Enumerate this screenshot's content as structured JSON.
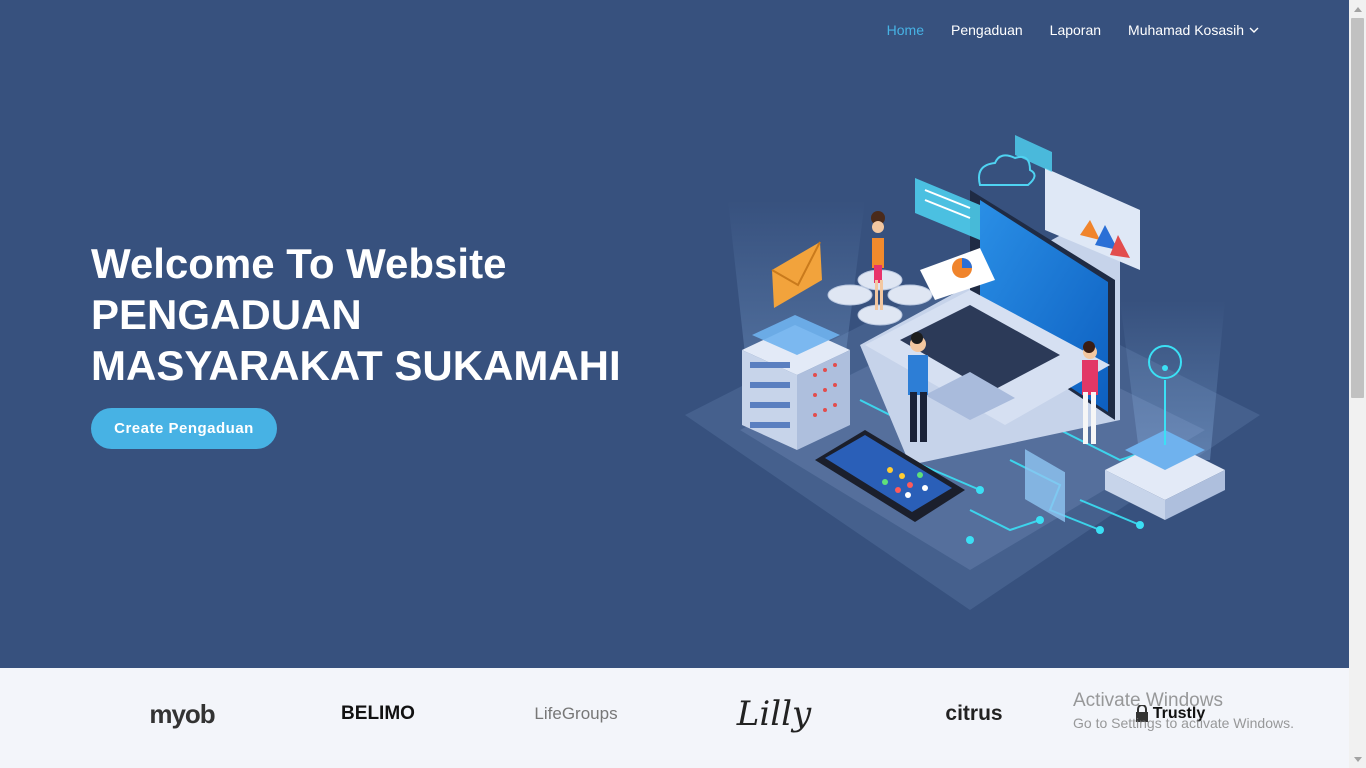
{
  "nav": {
    "items": [
      {
        "label": "Home",
        "active": true
      },
      {
        "label": "Pengaduan",
        "active": false
      },
      {
        "label": "Laporan",
        "active": false
      },
      {
        "label": "Muhamad Kosasih",
        "active": false,
        "dropdown": true
      }
    ]
  },
  "hero": {
    "line1": "Welcome To Website",
    "line2": "PENGADUAN",
    "line3": "MASYARAKAT SUKAMAHI",
    "cta_label": "Create Pengaduan"
  },
  "clients": [
    "myob",
    "BELIMO",
    "LifeGroups",
    "Lilly",
    "citrus",
    "Trustly"
  ],
  "watermark": {
    "line1": "Activate Windows",
    "line2": "Go to Settings to activate Windows."
  },
  "colors": {
    "hero_bg": "#37517e",
    "accent": "#47b2e4",
    "clients_bg": "#f3f5fa"
  },
  "icons": [
    "chevron-down-icon",
    "lock-icon"
  ]
}
